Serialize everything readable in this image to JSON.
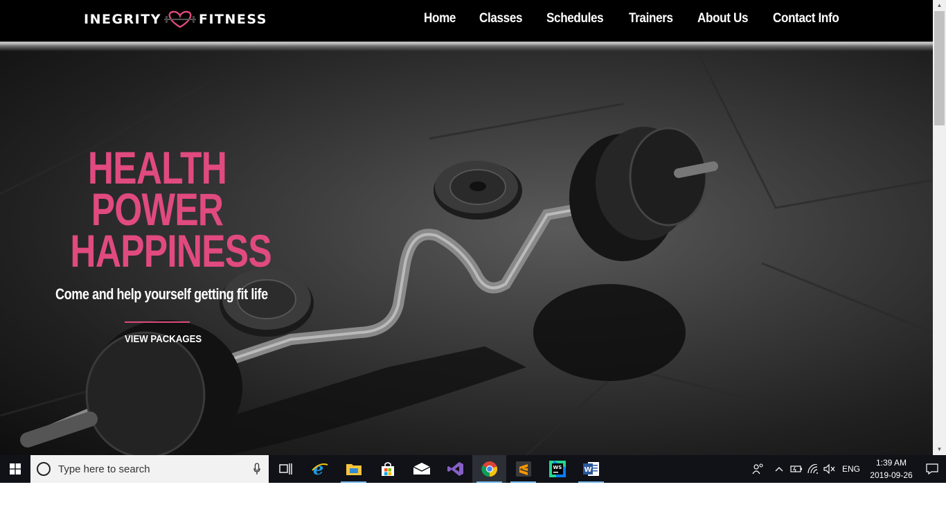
{
  "brand": {
    "name_left": "INEGRITY",
    "name_right": "FITNESS",
    "accent_color": "#e04a7f"
  },
  "nav": {
    "items": [
      {
        "label": "Home"
      },
      {
        "label": "Classes"
      },
      {
        "label": "Schedules"
      },
      {
        "label": "Trainers"
      },
      {
        "label": "About Us"
      },
      {
        "label": "Contact Info"
      }
    ]
  },
  "hero": {
    "title_lines": [
      "HEALTH",
      "POWER",
      "HAPPINESS"
    ],
    "subtitle": "Come and help yourself getting fit life",
    "cta_label": "VIEW PACKAGES",
    "background_description_icon": "barbell-weights-photo"
  },
  "taskbar": {
    "search_placeholder": "Type here to search",
    "pinned_icons": [
      {
        "name": "task-view-icon"
      },
      {
        "name": "internet-explorer-icon"
      },
      {
        "name": "file-explorer-icon"
      },
      {
        "name": "microsoft-store-icon"
      },
      {
        "name": "mail-icon"
      },
      {
        "name": "visual-studio-icon"
      },
      {
        "name": "chrome-icon"
      },
      {
        "name": "sublime-text-icon"
      },
      {
        "name": "webstorm-icon"
      },
      {
        "name": "word-icon"
      }
    ],
    "tray": {
      "language": "ENG",
      "time": "1:39 AM",
      "date": "2019-09-26"
    }
  }
}
